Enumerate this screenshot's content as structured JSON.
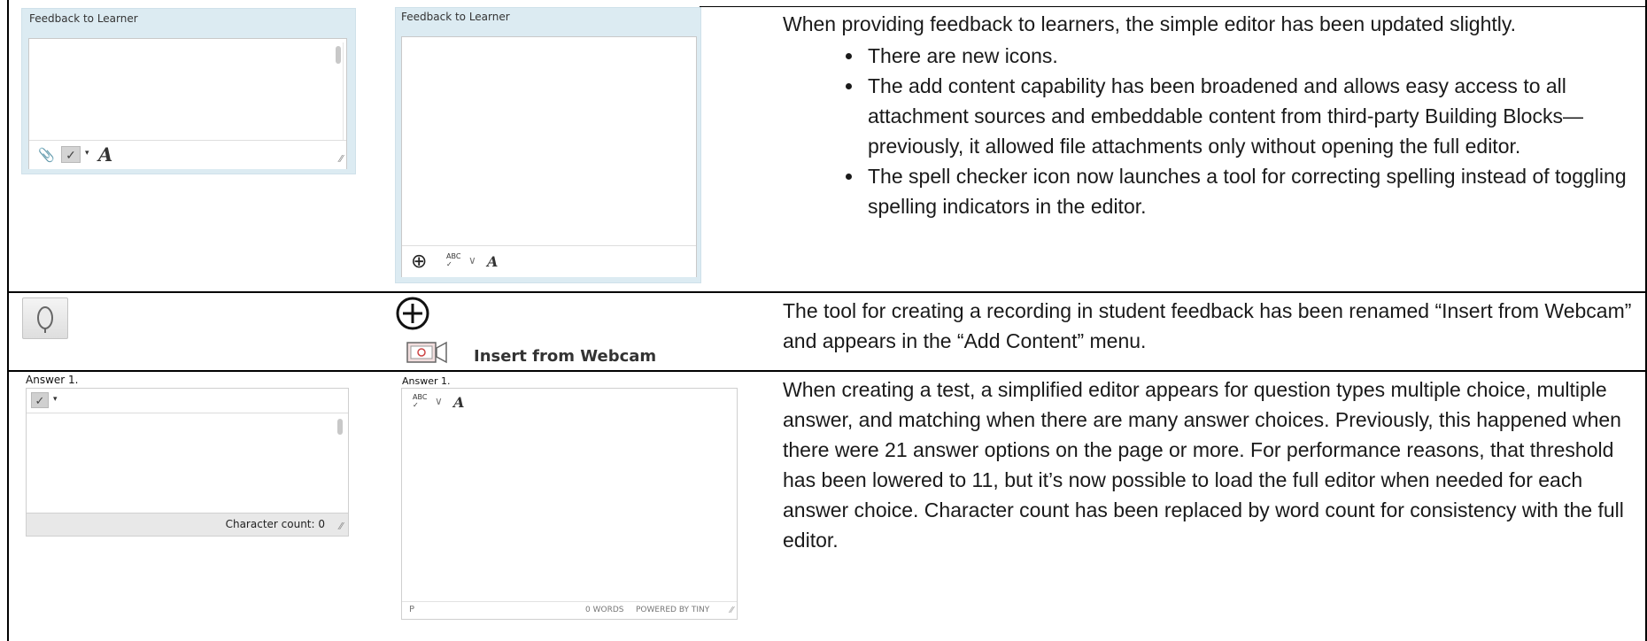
{
  "row1": {
    "old_editor": {
      "label": "Feedback to Learner"
    },
    "new_editor": {
      "label": "Feedback to Learner"
    },
    "description": {
      "intro": "When providing feedback to learners, the simple editor has been updated slightly.",
      "bullets": [
        "There are new icons.",
        "The add content capability has been broadened and allows easy access to all attachment sources and embeddable content from third-party Building Blocks—previously, it allowed file attachments only without opening the full editor.",
        "The spell checker icon now launches a tool for correcting spelling instead of toggling spelling indicators in the editor."
      ]
    }
  },
  "row2": {
    "webcam_label": "Insert from Webcam",
    "description": "The tool for creating a recording in student feedback has been renamed “Insert from Webcam” and appears in the “Add Content” menu."
  },
  "row3": {
    "old_editor": {
      "label": "Answer 1.",
      "char_count": "Character count: 0"
    },
    "new_editor": {
      "label": "Answer 1.",
      "path": "P",
      "word_count": "0 WORDS",
      "powered_by": "POWERED BY TINY"
    },
    "description": "When creating a test, a simplified editor appears for question types multiple choice, multiple answer, and matching when there are many answer choices. Previously, this happened when there were 21 answer options on the page or more. For performance reasons, that threshold has been lowered to 11, but it’s now possible to load the full editor when needed for each answer choice. Character count has been replaced by word count for consistency with the full editor."
  }
}
